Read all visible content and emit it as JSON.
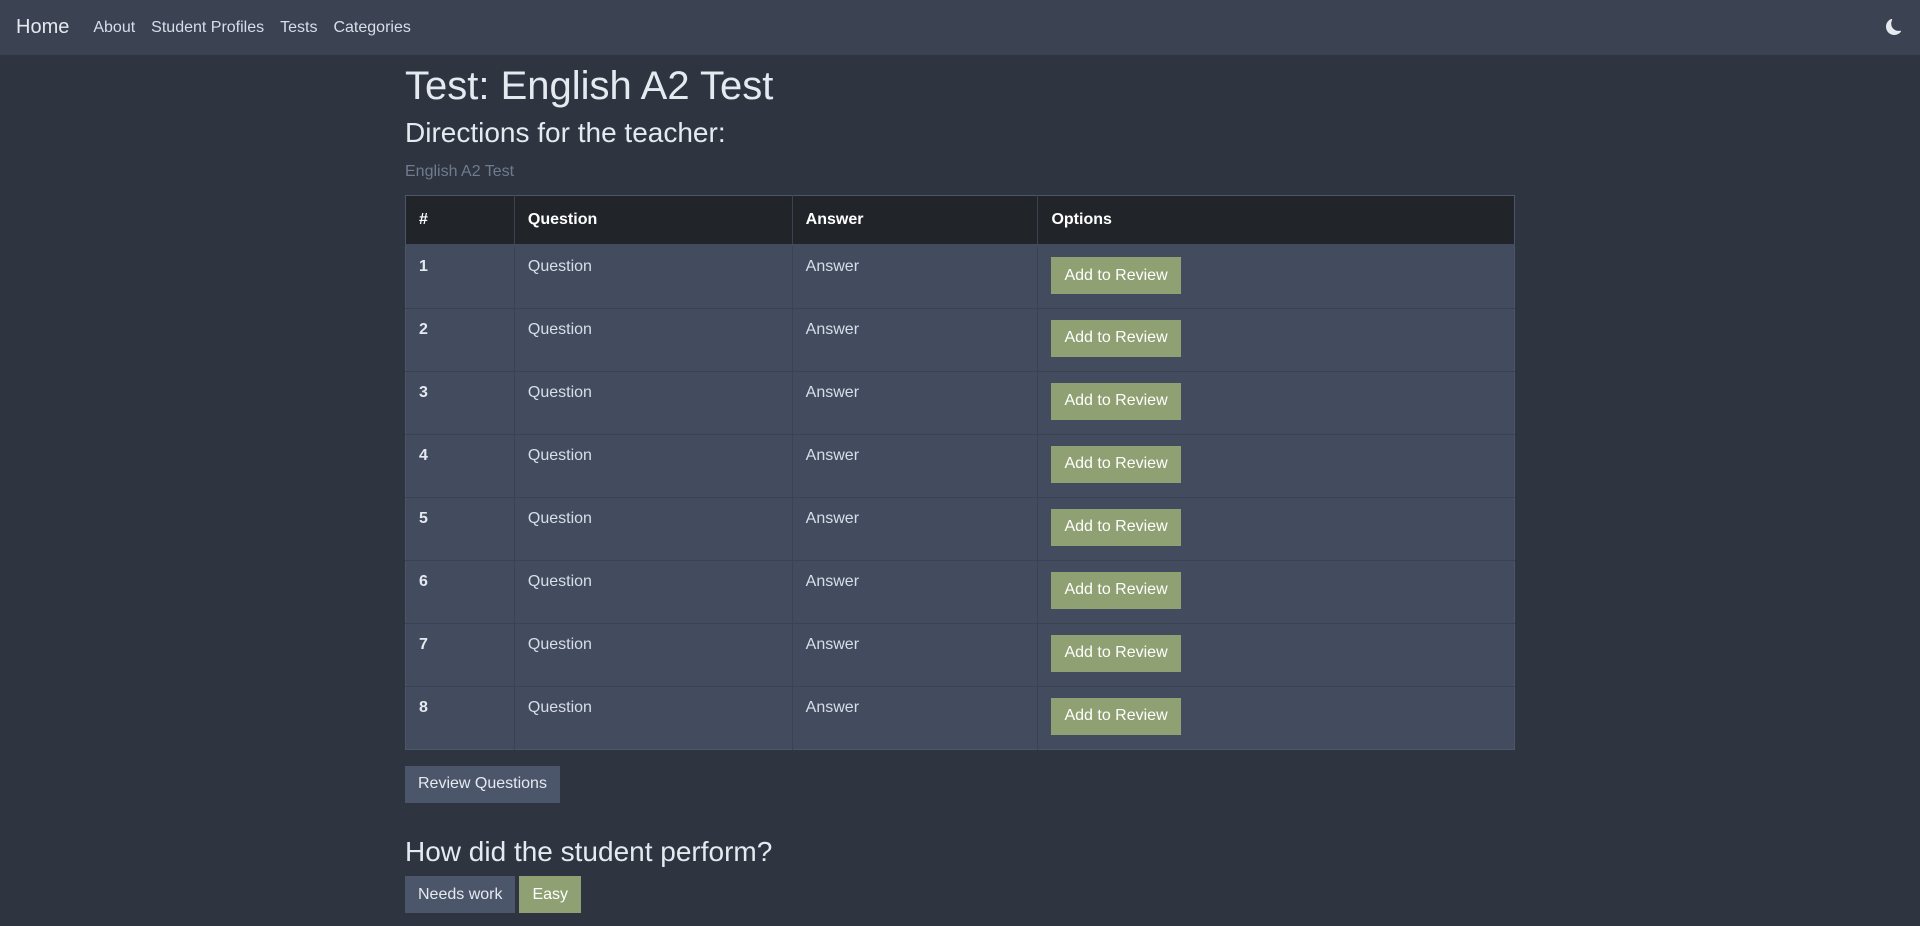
{
  "nav": {
    "brand": "Home",
    "links": [
      "About",
      "Student Profiles",
      "Tests",
      "Categories"
    ],
    "theme_icon": "moon-icon"
  },
  "page": {
    "title": "Test: English A2 Test",
    "directions_heading": "Directions for the teacher:",
    "directions_text": "English A2 Test"
  },
  "table": {
    "headers": [
      "#",
      "Question",
      "Answer",
      "Options"
    ],
    "rows": [
      {
        "num": "1",
        "question": "Question",
        "answer": "Answer",
        "action": "Add to Review"
      },
      {
        "num": "2",
        "question": "Question",
        "answer": "Answer",
        "action": "Add to Review"
      },
      {
        "num": "3",
        "question": "Question",
        "answer": "Answer",
        "action": "Add to Review"
      },
      {
        "num": "4",
        "question": "Question",
        "answer": "Answer",
        "action": "Add to Review"
      },
      {
        "num": "5",
        "question": "Question",
        "answer": "Answer",
        "action": "Add to Review"
      },
      {
        "num": "6",
        "question": "Question",
        "answer": "Answer",
        "action": "Add to Review"
      },
      {
        "num": "7",
        "question": "Question",
        "answer": "Answer",
        "action": "Add to Review"
      },
      {
        "num": "8",
        "question": "Question",
        "answer": "Answer",
        "action": "Add to Review"
      }
    ]
  },
  "review_button": "Review Questions",
  "performance": {
    "heading": "How did the student perform?",
    "buttons": [
      "Needs work",
      "Easy"
    ]
  },
  "colors": {
    "background": "#2e3440",
    "navbar": "#3b4252",
    "table_header": "#212529",
    "table_row": "#434c5e",
    "accent_green": "#8fa173",
    "slate_button": "#4c566a"
  }
}
